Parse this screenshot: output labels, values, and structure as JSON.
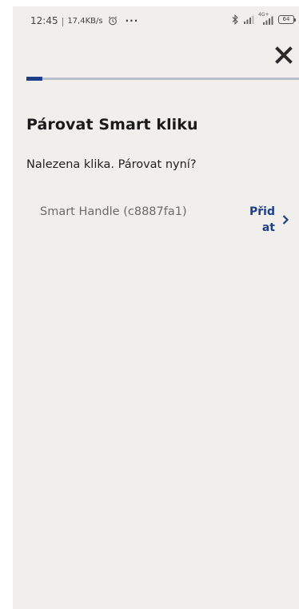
{
  "status_bar": {
    "time": "12:45",
    "separator": "|",
    "network_speed": "17,4KB/s",
    "more": "···",
    "network_tag": "4G+",
    "battery": "64"
  },
  "header": {
    "progress": 0.06
  },
  "main": {
    "title": "Párovat Smart kliku",
    "subtitle": "Nalezena klika. Párovat nyní?",
    "devices": [
      {
        "name": "Smart Handle (c8887fa1)",
        "action_label": "Přidat"
      }
    ]
  },
  "colors": {
    "background": "#f0efeb",
    "accent": "#1d3f8a",
    "progress_track": "#b9bfcc"
  },
  "icons": {
    "close": "close-icon",
    "chevron": "chevron-right-icon",
    "alarm": "alarm-clock-icon",
    "bluetooth": "bluetooth-icon",
    "signal": "cellular-signal-icon",
    "battery": "battery-icon"
  }
}
